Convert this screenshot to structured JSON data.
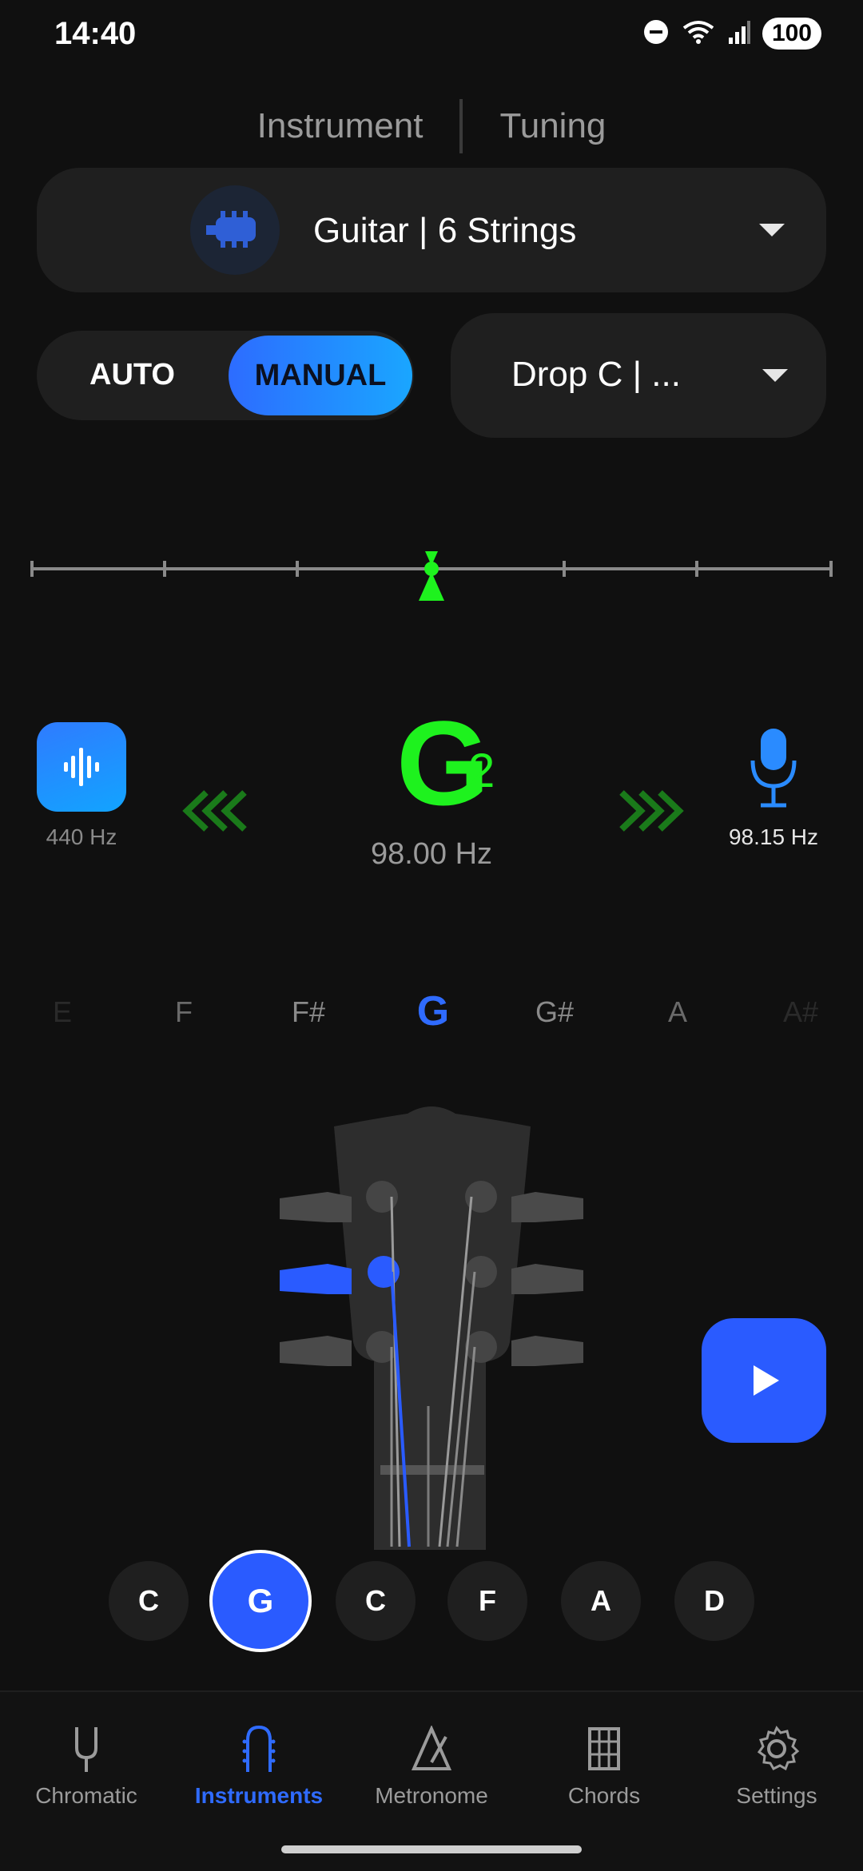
{
  "status_bar": {
    "time": "14:40",
    "battery": "100"
  },
  "top_tabs": [
    {
      "label": "Instrument"
    },
    {
      "label": "Tuning"
    }
  ],
  "instrument": {
    "label": "Guitar | 6 Strings"
  },
  "mode": {
    "auto_label": "AUTO",
    "manual_label": "MANUAL",
    "selected": "MANUAL"
  },
  "tuning": {
    "label": "Drop C | ..."
  },
  "tuner": {
    "note": "G",
    "octave": "2",
    "frequency": "98.00 Hz",
    "reference_label": "440 Hz",
    "detected_frequency": "98.15 Hz",
    "cents_offset": 0
  },
  "note_strip": [
    "E",
    "F",
    "F#",
    "G",
    "G#",
    "A",
    "A#"
  ],
  "note_strip_selected": "G",
  "strings": [
    "C",
    "G",
    "C",
    "F",
    "A",
    "D"
  ],
  "selected_string_index": 1,
  "nav": [
    {
      "label": "Chromatic",
      "icon": "tuning-fork-icon"
    },
    {
      "label": "Instruments",
      "icon": "instrument-icon"
    },
    {
      "label": "Metronome",
      "icon": "metronome-icon"
    },
    {
      "label": "Chords",
      "icon": "chords-icon"
    },
    {
      "label": "Settings",
      "icon": "gear-icon"
    }
  ],
  "nav_active_index": 1,
  "colors": {
    "accent": "#2a5bff",
    "in_tune": "#1ef21e",
    "background": "#101010"
  }
}
